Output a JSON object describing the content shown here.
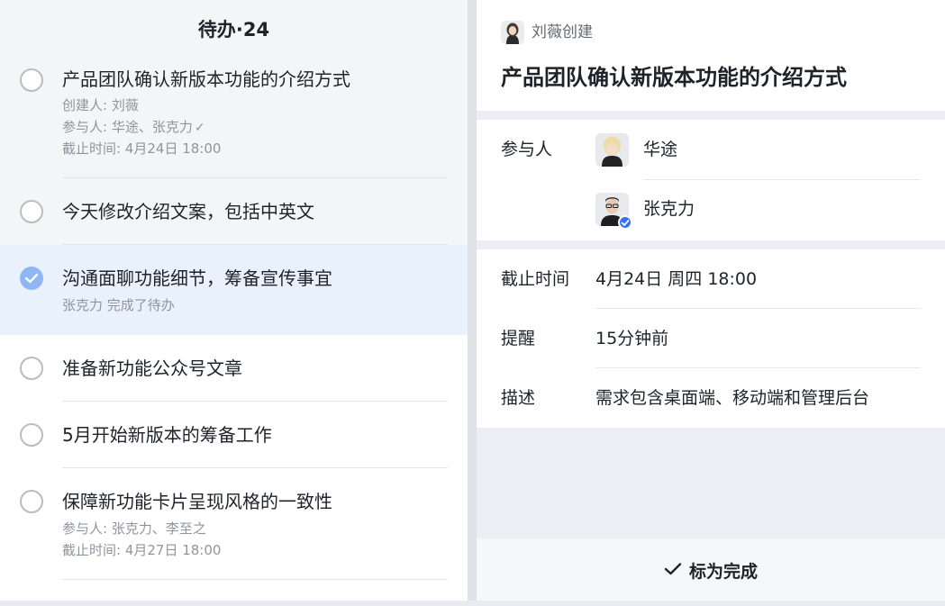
{
  "list": {
    "header": "待办·24",
    "tasks": [
      {
        "title": "产品团队确认新版本功能的介绍方式",
        "creator": "创建人: 刘薇",
        "participants": "参与人: 华途、张克力",
        "deadline": "截止时间: 4月24日 18:00",
        "done": false
      },
      {
        "title": "今天修改介绍文案，包括中英文",
        "done": false
      },
      {
        "title": "沟通面聊功能细节，筹备宣传事宜",
        "status": "张克力 完成了待办",
        "done": true
      },
      {
        "title": "准备新功能公众号文章",
        "done": false
      },
      {
        "title": "5月开始新版本的筹备工作",
        "done": false
      },
      {
        "title": "保障新功能卡片呈现风格的一致性",
        "participants": "参与人: 张克力、李至之",
        "deadline": "截止时间: 4月27日 18:00",
        "done": false
      }
    ]
  },
  "detail": {
    "creator": "刘薇创建",
    "title": "产品团队确认新版本功能的介绍方式",
    "participants_label": "参与人",
    "participants": [
      "华途",
      "张克力"
    ],
    "deadline_label": "截止时间",
    "deadline": "4月24日 周四 18:00",
    "reminder_label": "提醒",
    "reminder": "15分钟前",
    "description_label": "描述",
    "description": "需求包含桌面端、移动端和管理后台",
    "mark_done": "标为完成"
  },
  "colors": {
    "accent": "#3370ff",
    "done_circle": "#8fb7f5",
    "selected_row": "#e9f1fd"
  }
}
